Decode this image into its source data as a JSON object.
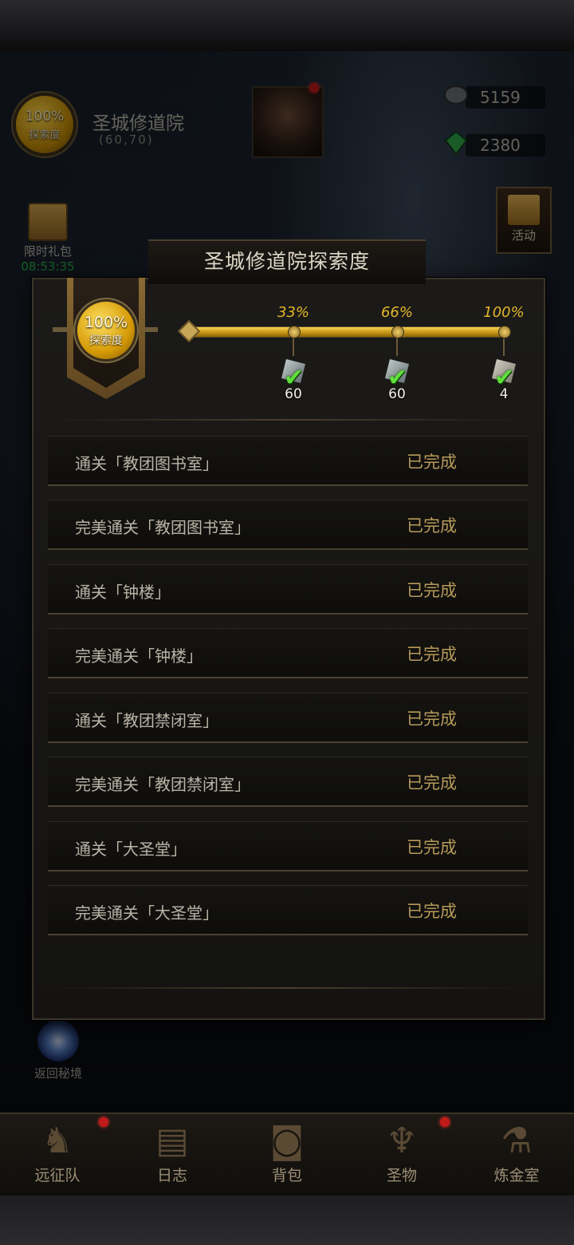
{
  "hud": {
    "exploration_percent": "100%",
    "exploration_label": "探索度",
    "location_name": "圣城修道院",
    "location_coord": "(60,70)",
    "resource_1_value": "5159",
    "resource_2_value": "2380",
    "activity_label": "活动",
    "limited_gift_label": "限时礼包",
    "limited_gift_timer": "08:53:35",
    "return_label": "返回秘境"
  },
  "panel": {
    "title": "圣城修道院探索度",
    "exploration_percent": "100%",
    "exploration_label": "探索度",
    "progress_value": 1.0,
    "milestones": [
      {
        "percent": "33%",
        "value": 0.33,
        "reward_count": "60",
        "reward_icon": "ore-icon",
        "claimed": true
      },
      {
        "percent": "66%",
        "value": 0.66,
        "reward_count": "60",
        "reward_icon": "ore-icon",
        "claimed": true
      },
      {
        "percent": "100%",
        "value": 1.0,
        "reward_count": "4",
        "reward_icon": "scroll-icon",
        "claimed": true
      }
    ],
    "tasks": [
      {
        "name": "通关「教团图书室」",
        "status": "已完成"
      },
      {
        "name": "完美通关「教团图书室」",
        "status": "已完成"
      },
      {
        "name": "通关「钟楼」",
        "status": "已完成"
      },
      {
        "name": "完美通关「钟楼」",
        "status": "已完成"
      },
      {
        "name": "通关「教团禁闭室」",
        "status": "已完成"
      },
      {
        "name": "完美通关「教团禁闭室」",
        "status": "已完成"
      },
      {
        "name": "通关「大圣堂」",
        "status": "已完成"
      },
      {
        "name": "完美通关「大圣堂」",
        "status": "已完成"
      }
    ]
  },
  "bottom_nav": [
    {
      "label": "远征队",
      "icon": "horned-helmet-icon",
      "badge": true
    },
    {
      "label": "日志",
      "icon": "map-scroll-icon",
      "badge": false
    },
    {
      "label": "背包",
      "icon": "backpack-icon",
      "badge": false
    },
    {
      "label": "圣物",
      "icon": "chalice-icon",
      "badge": true
    },
    {
      "label": "炼金室",
      "icon": "alchemy-icon",
      "badge": false
    }
  ],
  "colors": {
    "gold": "#e3b62a",
    "status": "#b89a5a",
    "check": "#5fe03a",
    "badge": "#c01a1a"
  }
}
